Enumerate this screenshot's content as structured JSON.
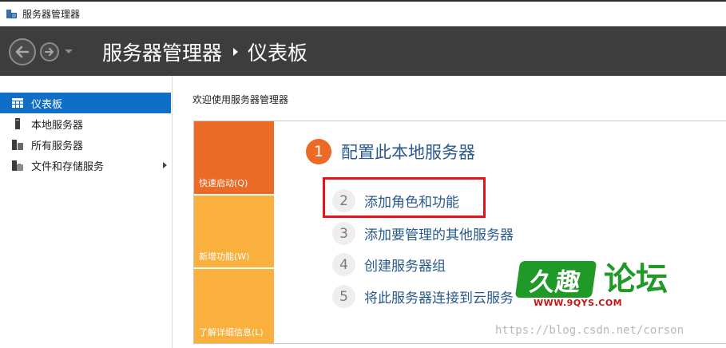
{
  "window": {
    "title": "服务器管理器"
  },
  "header": {
    "breadcrumb_root": "服务器管理器",
    "breadcrumb_current": "仪表板"
  },
  "sidebar": {
    "items": [
      {
        "label": "仪表板",
        "icon": "dashboard-grid-icon",
        "active": true
      },
      {
        "label": "本地服务器",
        "icon": "server-icon",
        "active": false
      },
      {
        "label": "所有服务器",
        "icon": "servers-icon",
        "active": false
      },
      {
        "label": "文件和存储服务",
        "icon": "file-storage-icon",
        "active": false,
        "has_submenu": true
      }
    ]
  },
  "main": {
    "welcome": "欢迎使用服务器管理器",
    "tiles": [
      {
        "label": "快速启动(Q)",
        "color": "#ea6a26"
      },
      {
        "label": "新增功能(W)",
        "color": "#f9b03d"
      },
      {
        "label": "了解详细信息(L)",
        "color": "#f9b03d"
      }
    ],
    "primary_step": {
      "number": "1",
      "label": "配置此本地服务器"
    },
    "steps": [
      {
        "number": "2",
        "label": "添加角色和功能",
        "highlighted": true
      },
      {
        "number": "3",
        "label": "添加要管理的其他服务器"
      },
      {
        "number": "4",
        "label": "创建服务器组"
      },
      {
        "number": "5",
        "label": "将此服务器连接到云服务"
      }
    ]
  },
  "watermark": {
    "logo_text": "久趣",
    "logo_suffix": "论坛",
    "logo_url": "WWW.9QYS.COM",
    "blog_url": "https://blog.csdn.net/corson"
  },
  "colors": {
    "header_bg": "#3d3d3d",
    "accent_blue": "#0f6fc6",
    "orange": "#ea6a26",
    "yellow": "#f9b03d",
    "highlight_red": "#e3141b",
    "link_blue": "#2a5a8c"
  }
}
